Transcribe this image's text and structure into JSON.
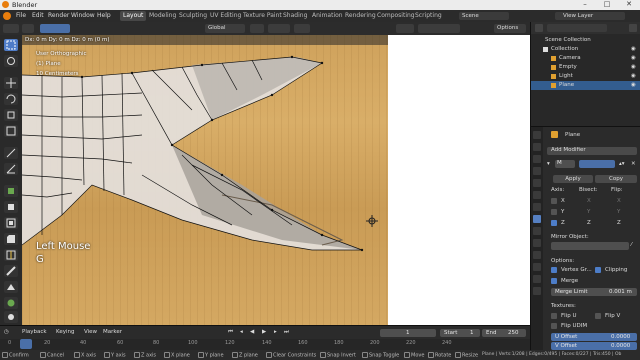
{
  "window": {
    "title": "Blender"
  },
  "menu": [
    "File",
    "Edit",
    "Render",
    "Window",
    "Help"
  ],
  "workspaces": [
    {
      "label": "Layout",
      "active": true
    },
    {
      "label": "Modeling"
    },
    {
      "label": "Sculpting"
    },
    {
      "label": "UV Editing"
    },
    {
      "label": "Texture Paint"
    },
    {
      "label": "Shading"
    },
    {
      "label": "Animation"
    },
    {
      "label": "Rendering"
    },
    {
      "label": "Compositing"
    },
    {
      "label": "Scripting"
    }
  ],
  "scene": {
    "label": "Scene"
  },
  "view_layer": {
    "label": "View Layer"
  },
  "header": {
    "orientation": "Global",
    "options": "Options"
  },
  "viewport": {
    "move_readout": "Dx: 0 m  Dy: 0 m  Dz: 0 m (0 m)",
    "mode_lines": [
      "User Orthographic",
      "(1) Plane",
      "10 Centimeters"
    ],
    "last_input": "Left Mouse",
    "last_key": "G"
  },
  "outliner": {
    "title": "Scene Collection",
    "items": [
      {
        "label": "Collection",
        "indent": 1
      },
      {
        "label": "Camera",
        "indent": 2
      },
      {
        "label": "Empty",
        "indent": 2
      },
      {
        "label": "Light",
        "indent": 2
      },
      {
        "label": "Plane",
        "indent": 2,
        "selected": true
      }
    ]
  },
  "properties": {
    "object_name": "Plane",
    "add_modifier": "Add Modifier",
    "modifier_short": "M",
    "apply": "Apply",
    "copy": "Copy",
    "axis_label": "Axis:",
    "bisect_label": "Bisect:",
    "flip_label": "Flip:",
    "axes": [
      "X",
      "Y",
      "Z"
    ],
    "mirror_object": "Mirror Object:",
    "options_label": "Options:",
    "vertex_groups": "Vertex Gr...",
    "clipping": "Clipping",
    "merge": "Merge",
    "merge_limit_label": "Merge Limit",
    "merge_limit_value": "0.001 m",
    "textures_label": "Textures:",
    "flip_u": "Flip U",
    "flip_v": "Flip V",
    "flip_udim": "Flip UDIM",
    "u_offset_label": "U Offset",
    "u_offset_value": "0.0000",
    "v_offset_label": "V Offset",
    "v_offset_value": "0.0000"
  },
  "timeline": {
    "playback": "Playback",
    "keying": "Keying",
    "view": "View",
    "marker": "Marker",
    "current_frame": "1",
    "start_label": "Start",
    "start": "1",
    "end_label": "End",
    "end": "250",
    "ruler": [
      "0",
      "20",
      "40",
      "60",
      "80",
      "100",
      "120",
      "140",
      "160",
      "180",
      "200",
      "220",
      "240"
    ]
  },
  "status": {
    "items": [
      "Confirm",
      "Cancel",
      "X axis",
      "Y axis",
      "Z axis",
      "X plane",
      "Y plane",
      "Z plane",
      "Clear Constraints",
      "Snap Invert",
      "Snap Toggle",
      "Move",
      "Rotate",
      "Resize"
    ],
    "stats": "Plane | Verts:1/208 | Edges:0/495 | Faces:0/227 | Tris:450 | Ob"
  }
}
